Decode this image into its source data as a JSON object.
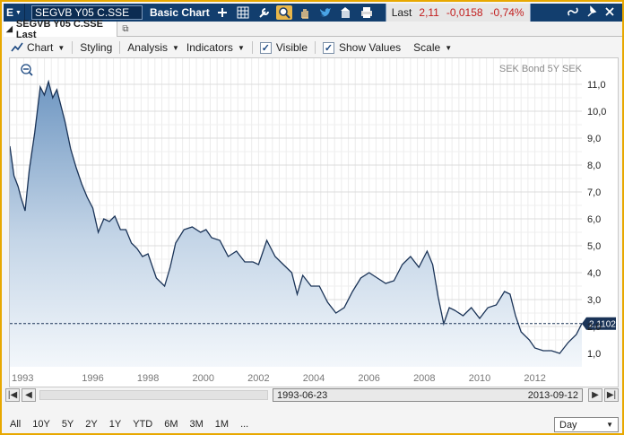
{
  "titlebar": {
    "menu_letter": "E",
    "symbol_value": "SEGVB Y05 C.SSE",
    "title": "Basic Chart",
    "last_label": "Last",
    "last_value": "2,11",
    "change": "-0,0158",
    "change_pct": "-0,74%"
  },
  "tab": {
    "label": "SEGVB Y05 C.SSE Last"
  },
  "toolbar": {
    "chart": "Chart",
    "styling": "Styling",
    "analysis": "Analysis",
    "indicators": "Indicators",
    "visible": "Visible",
    "show_values": "Show Values",
    "scale": "Scale"
  },
  "chart_data": {
    "type": "area",
    "title": "SEK Bond 5Y SEK",
    "xlabel": "",
    "ylabel": "",
    "x_ticks": [
      "1993",
      "1996",
      "1998",
      "2000",
      "2002",
      "2004",
      "2006",
      "2008",
      "2010",
      "2012"
    ],
    "y_ticks": [
      "1,0",
      "2,0",
      "3,0",
      "4,0",
      "5,0",
      "6,0",
      "7,0",
      "8,0",
      "9,0",
      "10,0",
      "11,0"
    ],
    "ylim": [
      0.5,
      11.7
    ],
    "xlim": [
      1993.0,
      2013.7
    ],
    "last_value_label": "2,1102",
    "x": [
      1993.0,
      1993.15,
      1993.3,
      1993.4,
      1993.55,
      1993.7,
      1993.9,
      1994.1,
      1994.25,
      1994.4,
      1994.55,
      1994.7,
      1994.85,
      1995.0,
      1995.2,
      1995.4,
      1995.6,
      1995.8,
      1996.0,
      1996.2,
      1996.4,
      1996.6,
      1996.8,
      1997.0,
      1997.2,
      1997.4,
      1997.6,
      1997.8,
      1998.0,
      1998.3,
      1998.6,
      1998.8,
      1999.0,
      1999.3,
      1999.6,
      1999.9,
      2000.1,
      2000.3,
      2000.6,
      2000.9,
      2001.2,
      2001.5,
      2001.8,
      2002.0,
      2002.3,
      2002.6,
      2002.9,
      2003.2,
      2003.4,
      2003.6,
      2003.9,
      2004.2,
      2004.5,
      2004.8,
      2005.1,
      2005.4,
      2005.7,
      2006.0,
      2006.3,
      2006.6,
      2006.9,
      2007.2,
      2007.5,
      2007.8,
      2008.1,
      2008.3,
      2008.5,
      2008.7,
      2008.9,
      2009.1,
      2009.4,
      2009.7,
      2010.0,
      2010.3,
      2010.6,
      2010.9,
      2011.1,
      2011.3,
      2011.5,
      2011.8,
      2012.0,
      2012.3,
      2012.6,
      2012.9,
      2013.2,
      2013.5,
      2013.7
    ],
    "values": [
      8.7,
      7.6,
      7.2,
      6.8,
      6.3,
      7.8,
      9.2,
      10.9,
      10.6,
      11.1,
      10.5,
      10.8,
      10.2,
      9.6,
      8.6,
      7.9,
      7.3,
      6.8,
      6.4,
      5.5,
      6.0,
      5.9,
      6.1,
      5.6,
      5.6,
      5.1,
      4.9,
      4.6,
      4.7,
      3.8,
      3.5,
      4.2,
      5.1,
      5.6,
      5.7,
      5.5,
      5.6,
      5.3,
      5.2,
      4.6,
      4.8,
      4.4,
      4.4,
      4.3,
      5.2,
      4.6,
      4.3,
      4.0,
      3.2,
      3.9,
      3.5,
      3.5,
      2.9,
      2.5,
      2.7,
      3.3,
      3.8,
      4.0,
      3.8,
      3.6,
      3.7,
      4.3,
      4.6,
      4.2,
      4.8,
      4.3,
      3.1,
      2.1,
      2.7,
      2.6,
      2.4,
      2.7,
      2.3,
      2.7,
      2.8,
      3.3,
      3.2,
      2.4,
      1.8,
      1.5,
      1.2,
      1.1,
      1.1,
      1.0,
      1.4,
      1.7,
      2.11
    ]
  },
  "navigator": {
    "start_date": "1993-06-23",
    "end_date": "2013-09-12"
  },
  "periods": [
    "All",
    "10Y",
    "5Y",
    "2Y",
    "1Y",
    "YTD",
    "6M",
    "3M",
    "1M",
    "..."
  ],
  "interval": {
    "value": "Day"
  }
}
